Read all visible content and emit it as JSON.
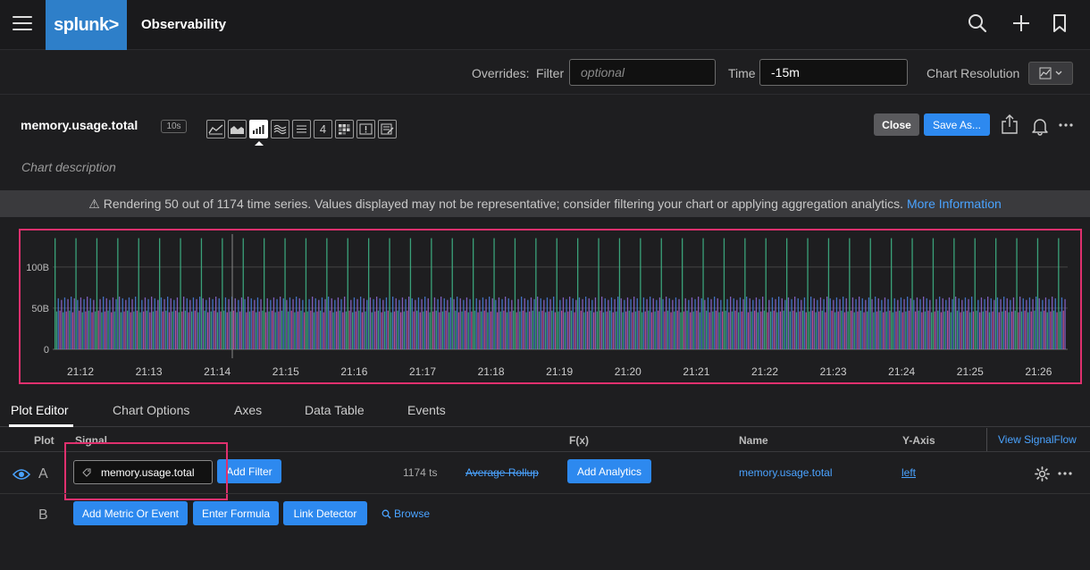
{
  "app": {
    "logo": "splunk>",
    "title": "Observability"
  },
  "overrides": {
    "label": "Overrides:",
    "filter_label": "Filter",
    "filter_placeholder": "optional",
    "time_label": "Time",
    "time_value": "-15m",
    "resolution_label": "Chart Resolution"
  },
  "chart_header": {
    "title": "memory.usage.total",
    "resolution_badge": "10s",
    "description_placeholder": "Chart description",
    "close_label": "Close",
    "save_label": "Save As...",
    "viz_types": [
      "line-chart-icon",
      "area-chart-icon",
      "column-chart-icon",
      "histogram-icon",
      "list-icon",
      "single-value-icon",
      "heatmap-icon",
      "event-feed-icon",
      "text-note-icon"
    ],
    "active_viz": "column-chart-icon",
    "single_value_glyph": "4"
  },
  "warning": {
    "icon": "⚠",
    "text": "Rendering 50 out of 1174 time series. Values displayed may not be representative; consider filtering your chart or applying aggregation analytics.",
    "link": "More Information"
  },
  "chart_data": {
    "type": "bar",
    "x_ticks": [
      "21:12",
      "21:13",
      "21:14",
      "21:15",
      "21:16",
      "21:17",
      "21:18",
      "21:19",
      "21:20",
      "21:21",
      "21:22",
      "21:23",
      "21:24",
      "21:25",
      "21:26"
    ],
    "y_ticks": [
      "0",
      "50B",
      "100B"
    ],
    "ylim": [
      0,
      140
    ],
    "colors": {
      "purple": "#8e6bd8",
      "green": "#3fb98a",
      "blue": "#4a7fe0",
      "pink": "#d25aa8"
    },
    "typical_levels_B": {
      "spikes": 135,
      "mid": 64,
      "base": 47
    }
  },
  "tabs": [
    "Plot Editor",
    "Chart Options",
    "Axes",
    "Data Table",
    "Events"
  ],
  "plot_editor": {
    "headers": {
      "plot": "Plot",
      "signal": "Signal",
      "fx": "F(x)",
      "name": "Name",
      "yaxis": "Y-Axis",
      "view_signalflow": "View SignalFlow"
    },
    "row_a": {
      "letter": "A",
      "signal": "memory.usage.total",
      "add_filter": "Add Filter",
      "ts_count": "1174 ts",
      "rollup": "Average Rollup",
      "add_analytics": "Add Analytics",
      "name": "memory.usage.total",
      "yaxis": "left"
    },
    "row_b": {
      "letter": "B",
      "add_metric": "Add Metric Or Event",
      "enter_formula": "Enter Formula",
      "link_detector": "Link Detector",
      "browse": "Browse"
    }
  }
}
